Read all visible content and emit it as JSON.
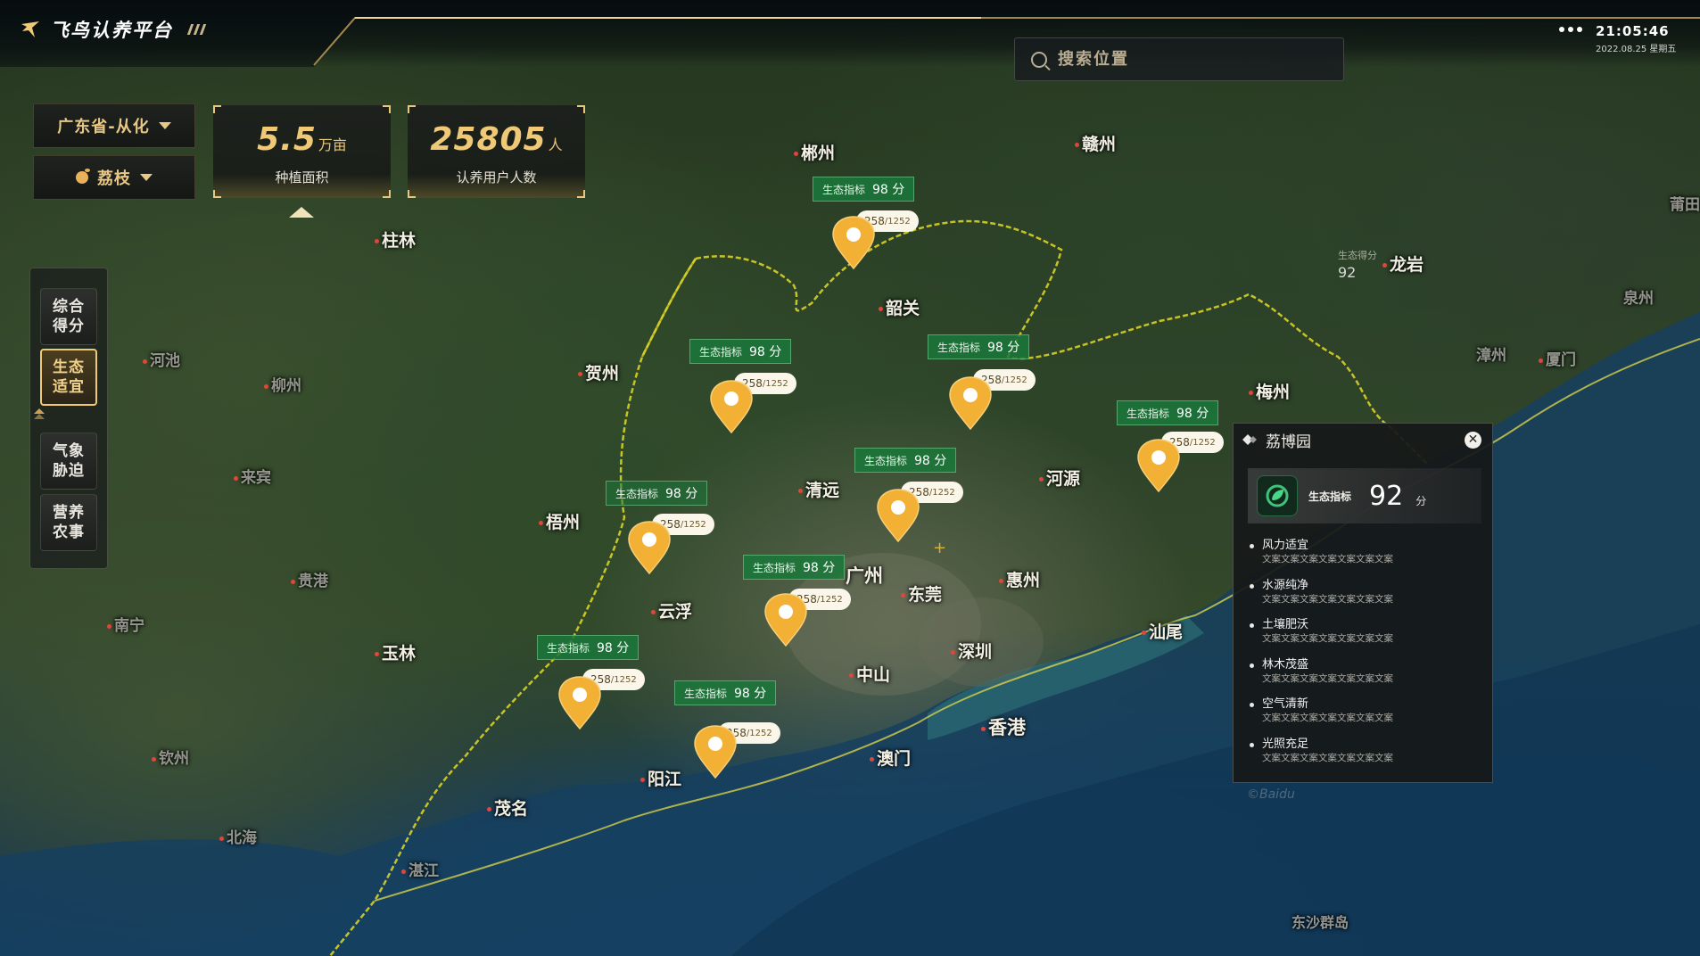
{
  "app": {
    "title": "飞鸟认养平台"
  },
  "search": {
    "placeholder": "搜索位置"
  },
  "clock": {
    "time": "21:05:46",
    "date": "2022.08.25 星期五"
  },
  "filters": {
    "region": "广东省-从化",
    "crop": "荔枝"
  },
  "stats": [
    {
      "value": "5.5",
      "unit": "万亩",
      "label": "种植面积"
    },
    {
      "value": "25805",
      "unit": "人",
      "label": "认养用户人数"
    }
  ],
  "sidenav": [
    {
      "label": "综合得分",
      "active": false
    },
    {
      "label": "生态适宜",
      "active": true
    },
    {
      "label": "气象胁迫",
      "active": false
    },
    {
      "label": "营养农事",
      "active": false
    }
  ],
  "cities": [
    "郴州",
    "赣州",
    "柱林",
    "韶关",
    "龙岩",
    "莆田",
    "泉州",
    "河池",
    "柳州",
    "贺州",
    "漳州",
    "厦门",
    "梅州",
    "来宾",
    "清远",
    "河源",
    "梧州",
    "广州",
    "东莞",
    "惠州",
    "贵港",
    "云浮",
    "南宁",
    "玉林",
    "中山",
    "深圳",
    "汕尾",
    "香港",
    "澳门",
    "钦州",
    "阳江",
    "茂名",
    "北海",
    "湛江",
    "东沙群岛"
  ],
  "map_overlay": {
    "label": "生态得分",
    "value": "92"
  },
  "markers": [
    {
      "eco_label": "生态指标",
      "score": "98 分",
      "count": "258",
      "total": "/1252"
    },
    {
      "eco_label": "生态指标",
      "score": "98 分",
      "count": "258",
      "total": "/1252"
    },
    {
      "eco_label": "生态指标",
      "score": "98 分",
      "count": "258",
      "total": "/1252"
    },
    {
      "eco_label": "生态指标",
      "score": "98 分",
      "count": "258",
      "total": "/1252"
    },
    {
      "eco_label": "生态指标",
      "score": "98 分",
      "count": "258",
      "total": "/1252"
    },
    {
      "eco_label": "生态指标",
      "score": "98 分",
      "count": "258",
      "total": "/1252"
    },
    {
      "eco_label": "生态指标",
      "score": "98 分",
      "count": "258",
      "total": "/1252"
    },
    {
      "eco_label": "生态指标",
      "score": "98 分",
      "count": "258",
      "total": "/1252"
    },
    {
      "eco_label": "生态指标",
      "score": "98 分",
      "count": "258",
      "total": "/1252"
    }
  ],
  "panel": {
    "title": "荔博园",
    "score_label": "生态指标",
    "score": "92",
    "score_unit": "分",
    "items": [
      {
        "title": "风力适宜",
        "desc": "文案文案文案文案文案文案文案"
      },
      {
        "title": "水源纯净",
        "desc": "文案文案文案文案文案文案文案"
      },
      {
        "title": "土壤肥沃",
        "desc": "文案文案文案文案文案文案文案"
      },
      {
        "title": "林木茂盛",
        "desc": "文案文案文案文案文案文案文案"
      },
      {
        "title": "空气清新",
        "desc": "文案文案文案文案文案文案文案"
      },
      {
        "title": "光照充足",
        "desc": "文案文案文案文案文案文案文案"
      }
    ]
  },
  "watermarks": [
    "©Baidu"
  ],
  "colors": {
    "accent": "#f0c977",
    "eco_tag": "#1a783a",
    "pin": "#f2b134",
    "panel_bg": "#161818"
  }
}
